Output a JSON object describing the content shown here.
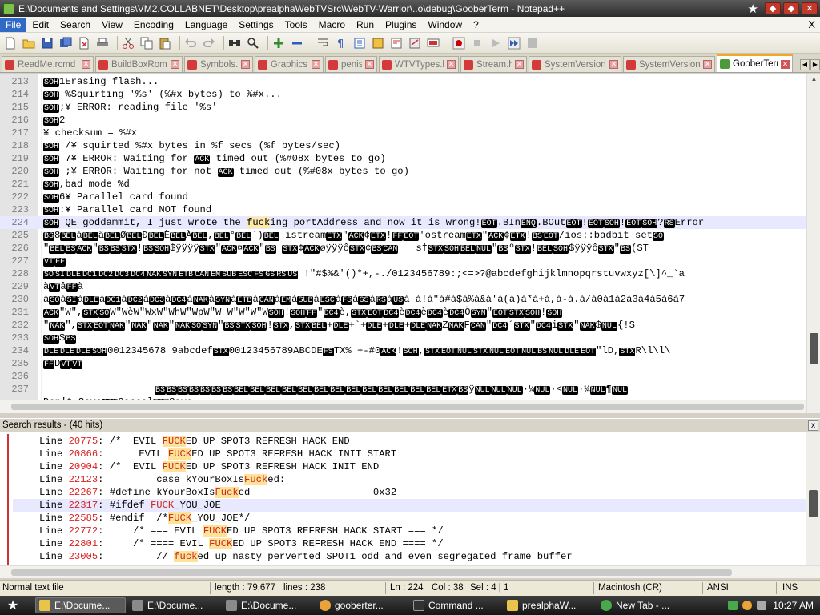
{
  "window": {
    "title": "E:\\Documents and Settings\\VM2.COLLABNET\\Desktop\\prealphaWebTVSrc\\WebTV-Warrior\\..o\\debug\\GooberTerm - Notepad++"
  },
  "menu": {
    "items": [
      "File",
      "Edit",
      "Search",
      "View",
      "Encoding",
      "Language",
      "Settings",
      "Tools",
      "Macro",
      "Run",
      "Plugins",
      "Window",
      "?"
    ],
    "close": "X"
  },
  "tabs": [
    {
      "label": "ReadMe.rcmd",
      "active": false
    },
    {
      "label": "BuildBoxRom.pl",
      "active": false
    },
    {
      "label": "Symbols.h",
      "active": false
    },
    {
      "label": "Graphics.c",
      "active": false
    },
    {
      "label": "penis",
      "active": false
    },
    {
      "label": "WTVTypes.h",
      "active": false
    },
    {
      "label": "Stream.h",
      "active": false
    },
    {
      "label": "SystemVersion.h",
      "active": false
    },
    {
      "label": "SystemVersion.c",
      "active": false
    },
    {
      "label": "GooberTerm",
      "active": true
    }
  ],
  "editor": {
    "lines": [
      {
        "n": "213",
        "cc": "SOH",
        "text": "1Erasing flash..."
      },
      {
        "n": "214",
        "cc": "SOH",
        "text": " %Squirting '%s' (%#x bytes) to %#x..."
      },
      {
        "n": "215",
        "cc": "SOH",
        "text": ";¥ ERROR: reading file '%s'"
      },
      {
        "n": "216",
        "cc": "SOH",
        "text": "2"
      },
      {
        "n": "217",
        "cc": "",
        "text": "¥ checksum = %#x"
      },
      {
        "n": "218",
        "cc": "SOH",
        "text": " /¥ squirted %#x bytes in %f secs (%f bytes/sec)"
      },
      {
        "n": "219",
        "cc": "SOH",
        "text": " 7¥ ERROR: Waiting for ACK timed out (%#08x bytes to go)"
      },
      {
        "n": "220",
        "cc": "SOH",
        "text": " ;¥ ERROR: Waiting for not ACK timed out (%#08x bytes to go)"
      },
      {
        "n": "221",
        "cc": "SOH",
        "text": ",bad mode %d"
      },
      {
        "n": "222",
        "cc": "SOH",
        "text": "6¥ Parallel card found"
      },
      {
        "n": "223",
        "cc": "SOH",
        "text": ":¥ Parallel card NOT found"
      },
      {
        "n": "224",
        "cc": "SOH",
        "text": " QE goddammit, I just wrote the fucking portAddress and now it is wrong!EOT.BInENQ.BOutEOT!EOTSOH!EOTSOH?RSError"
      },
      {
        "n": "225",
        "cc": "BS",
        "text": "8BELàBELâBELØBELÐBELÈBELÀBEL,BEL°BEL`)BEL istreamETX\"ACK¢ETX!FFEOT'ostreamETX\"ACK¢ETX!BSEOT/ios::badbit setSO"
      },
      {
        "n": "226",
        "cc": "",
        "text": "\"BELBSACK\"BSBSSTX!BSSOH$ÿÿÿÿSTX\"ACK¤ACK\"BS STX¢ACKøÿÿÿôSTX¢BSCAN   s†STXSOHBELNUL\"BSºSTX!BELSOH$ÿÿÿôSTX\"BS(ST"
      },
      {
        "n": "227",
        "cc": "VT",
        "text": "FF"
      },
      {
        "n": "228",
        "cc": "SO",
        "text": "SIDLEDC1DC2DC3DC4NAKSYNETBCANEMSUBESCFSGSRSUS !\"#$%&'()*+,-./0123456789:;<=>?@abcdefghijklmnopqrstuvwxyz[\\]^_`a"
      },
      {
        "n": "229",
        "cc": "",
        "text": "àVTâFFà"
      },
      {
        "n": "230",
        "cc": "",
        "text": "àSOàSIàDLEàDC1àDC2àDC3àDC4àNAKàSYNàETBàCANàEMàSUBàESCàFSàGSàRSàUSà à!à\"à#à$à%à&à'à(à)à*à+à,à-à.à/à0à1à2à3à4à5à6à7"
      },
      {
        "n": "231",
        "cc": "ACK",
        "text": "\"W\",STXSOW\"WèW\"WxW\"WhW\"WpW\"W W\"W\"W\"WSOH!SOHFF\"DC4è,STXEOTDC4èDC4èDC4èDC4ÒSYN\"EOTSTXSOH!SOH"
      },
      {
        "n": "232",
        "cc": "",
        "text": "\"NAK\",STXEOTNAK\"NAK\"NAK\"NAKSOSYN\"BSSTXSOH!STX,STXBEL+DLE+`+DLE+DLE+DLENAKZNAKFCAN\"DC4´STX\"DC4iSTX\"NAK$NUL{!S"
      },
      {
        "n": "233",
        "cc": "SOH",
        "text": "$BS"
      },
      {
        "n": "234",
        "cc": "DLE",
        "text": "DLEDLESOH0012345678 9abcdefSTX00123456789ABCDEFSTX% +-#0ACK!SOH,STXEOTNULSTXNULEOTNULBSNULDLEEOT\"lD,STXR\\l\\l\\"
      },
      {
        "n": "235",
        "cc": "FF",
        "text": "DVTVT"
      },
      {
        "n": "236",
        "cc": "",
        "text": ""
      },
      {
        "n": "237",
        "cc": "",
        "text": "                   BSBSBSBSBSBSBSBELBELBELBELBELBELBELBELBELBELBELBELBELETXBSÿNULNULNUL·¼NUL·<NUL·¼NUL¶NUL"
      },
      {
        "n": "",
        "cc": "",
        "text": "Don't SaveACKCancelEOTSave"
      }
    ],
    "current_line": "224",
    "highlight_word": "fuck"
  },
  "search_panel": {
    "title": "Search results - (40 hits)",
    "rows": [
      {
        "line": "20775",
        "pre": ": /*  EVIL ",
        "hit": "FUCK",
        "post": "ED UP SPOT3 REFRESH HACK END"
      },
      {
        "line": "20866",
        "pre": ":      EVIL ",
        "hit": "FUCK",
        "post": "ED UP SPOT3 REFRESH HACK INIT START"
      },
      {
        "line": "20904",
        "pre": ": /*  EVIL ",
        "hit": "FUCK",
        "post": "ED UP SPOT3 REFRESH HACK INIT END"
      },
      {
        "line": "22123",
        "pre": ":         case kYourBoxIs",
        "hit": "Fuck",
        "post": "ed:"
      },
      {
        "line": "22267",
        "pre": ": #define kYourBoxIs",
        "hit": "Fuck",
        "post": "ed                     0x32"
      },
      {
        "line": "22317",
        "pre": ": #ifdef ",
        "hit": "FUCK",
        "post": "_YOU_JOE"
      },
      {
        "line": "22585",
        "pre": ": #endif  /*",
        "hit": "FUCK",
        "post": "_YOU_JOE*/"
      },
      {
        "line": "22772",
        "pre": ":     /* === EVIL ",
        "hit": "FUCK",
        "post": "ED UP SPOT3 REFRESH HACK START === */"
      },
      {
        "line": "22801",
        "pre": ":     /* ==== EVIL ",
        "hit": "FUCK",
        "post": "ED UP SPOT3 REFRESH HACK END ==== */"
      },
      {
        "line": "23005",
        "pre": ":         // ",
        "hit": "fuck",
        "post": "ed up nasty perverted SPOT1 odd and even segregated frame buffer"
      }
    ],
    "line_prefix": "Line ",
    "close": "x"
  },
  "status": {
    "file_type": "Normal text file",
    "length": "length : 79,677",
    "lines": "lines : 238",
    "ln": "Ln : 224",
    "col": "Col : 38",
    "sel": "Sel : 4 | 1",
    "eol": "Macintosh (CR)",
    "encoding": "ANSI",
    "mode": "INS"
  },
  "taskbar": {
    "tasks": [
      {
        "label": "E:\\Docume...",
        "icon_color": "#e8c44a",
        "active": true
      },
      {
        "label": "E:\\Docume...",
        "icon_color": "#8a8a8a",
        "active": false
      },
      {
        "label": "E:\\Docume...",
        "icon_color": "#8a8a8a",
        "active": false
      },
      {
        "label": "gooberter...",
        "icon_color": "#e8a33a",
        "active": false
      },
      {
        "label": "Command ...",
        "icon_color": "#333333",
        "active": false
      },
      {
        "label": "prealphaW...",
        "icon_color": "#e8c44a",
        "active": false
      },
      {
        "label": "New Tab - ...",
        "icon_color": "#49a84a",
        "active": false
      }
    ],
    "clock": "10:27 AM"
  },
  "colors": {
    "accent": "#316ac5",
    "control_char_bg": "#000000",
    "search_hit_bg": "#ffe29a",
    "search_line_number": "#d92323"
  }
}
